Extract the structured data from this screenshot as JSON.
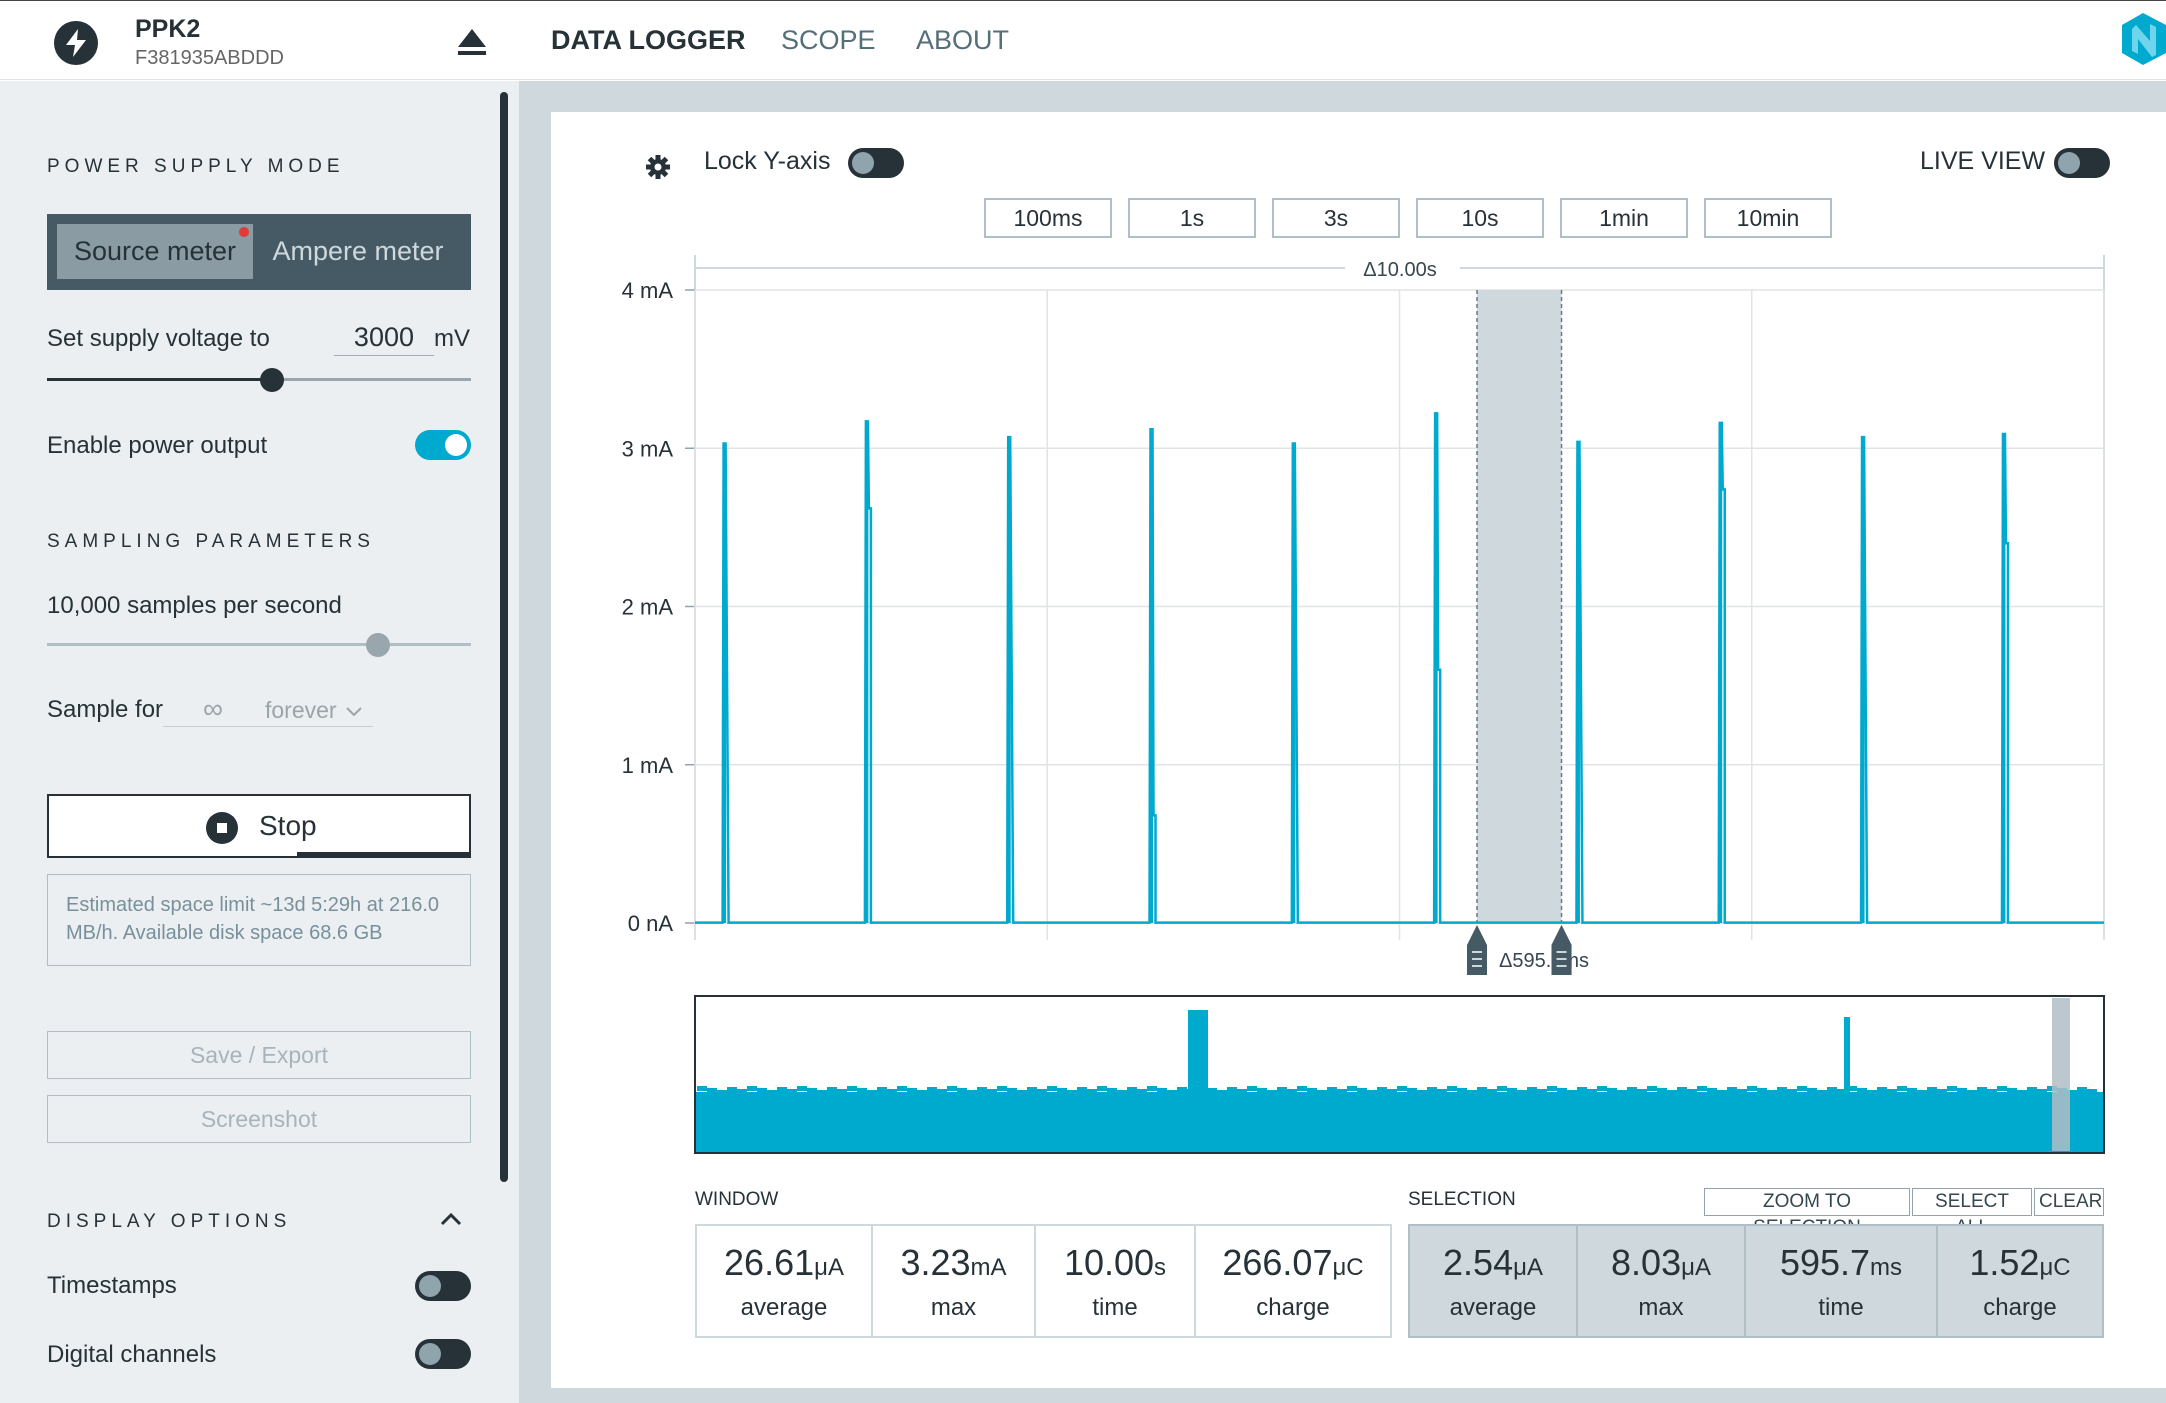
{
  "device": {
    "name": "PPK2",
    "serial": "F381935ABDDD"
  },
  "nav": {
    "tabs": [
      "DATA LOGGER",
      "SCOPE",
      "ABOUT"
    ],
    "active": "DATA LOGGER"
  },
  "sidebar": {
    "power_supply_title": "POWER SUPPLY MODE",
    "mode_source": "Source meter",
    "mode_ampere": "Ampere meter",
    "voltage_label": "Set supply voltage to",
    "voltage_value": "3000",
    "voltage_unit": "mV",
    "voltage_slider_fraction": 0.53,
    "power_output_label": "Enable power output",
    "power_output_on": true,
    "sampling_title": "SAMPLING PARAMETERS",
    "samples_label": "10,000 samples per second",
    "samples_slider_fraction": 0.78,
    "sample_for_label": "Sample for",
    "sample_for_value": "∞",
    "sample_for_unit": "forever",
    "stop_label": "Stop",
    "space_info": "Estimated space limit ~13d 5:29h at 216.0 MB/h. Available disk space 68.6 GB",
    "save_label": "Save / Export",
    "screenshot_label": "Screenshot",
    "display_title": "DISPLAY OPTIONS",
    "timestamps_label": "Timestamps",
    "timestamps_on": false,
    "digital_label": "Digital channels",
    "digital_on": false
  },
  "chart_controls": {
    "lock_y_label": "Lock Y-axis",
    "lock_y_on": false,
    "live_view_label": "LIVE VIEW",
    "live_view_on": false,
    "time_buttons": [
      "100ms",
      "1s",
      "3s",
      "10s",
      "1min",
      "10min"
    ]
  },
  "colors": {
    "accent": "#00a9ce",
    "dark": "#263238",
    "selection": "#cfd8dc"
  },
  "chart_data": {
    "type": "line",
    "window_label": "Δ10.00s",
    "selection_label": "Δ595.7ms",
    "x_unit": "s",
    "xlim": [
      0,
      10
    ],
    "y_ticks": [
      "4 mA",
      "3 mA",
      "2 mA",
      "1 mA",
      "0 nA"
    ],
    "ylim": [
      0,
      4
    ],
    "y_unit": "mA",
    "baseline": 0.0025,
    "spikes": [
      {
        "t": 0.21,
        "peak": 3.03
      },
      {
        "t": 1.22,
        "peak": 3.17,
        "second": 2.62
      },
      {
        "t": 2.23,
        "peak": 3.07
      },
      {
        "t": 3.24,
        "peak": 3.12,
        "second": 0.68
      },
      {
        "t": 4.25,
        "peak": 3.03
      },
      {
        "t": 5.26,
        "peak": 3.22,
        "second": 1.6
      },
      {
        "t": 6.27,
        "peak": 3.04
      },
      {
        "t": 7.28,
        "peak": 3.16,
        "second": 2.74
      },
      {
        "t": 8.29,
        "peak": 3.07
      },
      {
        "t": 9.29,
        "peak": 3.09,
        "second": 2.4
      }
    ],
    "selection": [
      5.55,
      6.15
    ]
  },
  "window_stats": {
    "title": "WINDOW",
    "items": [
      {
        "value": "26.61",
        "unit": "μA",
        "label": "average"
      },
      {
        "value": "3.23",
        "unit": "mA",
        "label": "max"
      },
      {
        "value": "10.00",
        "unit": "s",
        "label": "time"
      },
      {
        "value": "266.07",
        "unit": "μC",
        "label": "charge"
      }
    ]
  },
  "selection_stats": {
    "title": "SELECTION",
    "zoom_label": "ZOOM TO SELECTION",
    "select_all_label": "SELECT ALL",
    "clear_label": "CLEAR",
    "items": [
      {
        "value": "2.54",
        "unit": "μA",
        "label": "average"
      },
      {
        "value": "8.03",
        "unit": "μA",
        "label": "max"
      },
      {
        "value": "595.7",
        "unit": "ms",
        "label": "time"
      },
      {
        "value": "1.52",
        "unit": "μC",
        "label": "charge"
      }
    ]
  }
}
